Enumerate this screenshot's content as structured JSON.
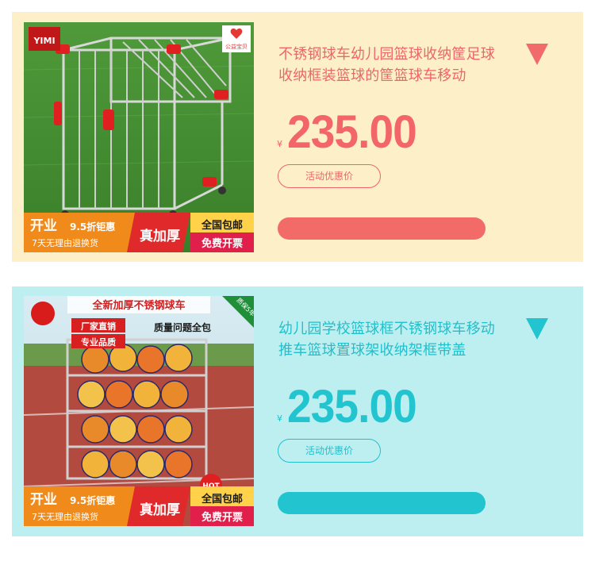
{
  "products": [
    {
      "title": "不锈钢球车幼儿园篮球收纳筐足球收纳框装篮球的筐篮球车移动",
      "currency": "¥",
      "price": "235.00",
      "promo_label": "活动优惠价",
      "thumb": {
        "top_badge": "公益宝贝",
        "logo": "YIMI",
        "banner_left_top": "开业",
        "banner_discount": "9.5折钜惠",
        "banner_left_bottom": "7天无理由退换货",
        "banner_thick": "真加厚",
        "banner_right_top": "全国包邮",
        "banner_right_bottom": "免费开票"
      }
    },
    {
      "title": "幼儿园学校篮球框不锈钢球车移动推车篮球置球架收纳架框带盖",
      "currency": "¥",
      "price": "235.00",
      "promo_label": "活动优惠价",
      "thumb": {
        "corner_badge": "质保5年",
        "headline": "全新加厚不锈钢球车",
        "tag_factory": "厂家直销",
        "tag_quality": "专业品质",
        "tag_guarantee": "质量问题全包",
        "hot": "HOT",
        "banner_left_top": "开业",
        "banner_discount": "9.5折钜惠",
        "banner_left_bottom": "7天无理由退换货",
        "banner_thick": "真加厚",
        "banner_right_top": "全国包邮",
        "banner_right_bottom": "免费开票"
      }
    }
  ],
  "colors": {
    "card1_bg": "#fdefc7",
    "card1_accent": "#f26b69",
    "card2_bg": "#bdeff1",
    "card2_accent": "#22c4cf"
  },
  "icons": {
    "expand": "triangle-down-icon"
  }
}
